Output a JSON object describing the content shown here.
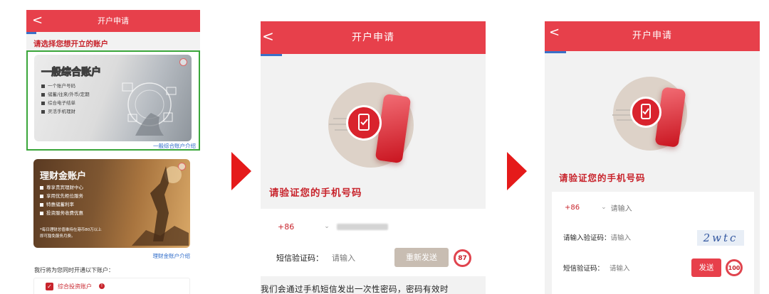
{
  "panel1": {
    "header_title": "开户申请",
    "back_icon": "<",
    "prompt": "请选择您想开立的账户",
    "card1": {
      "title": "一般综合账户",
      "features": [
        "一个账户号码",
        "储蓄/往来/外币/定期",
        "综合电子结单",
        "灵活手机理财"
      ],
      "link": "一般综合账户介绍"
    },
    "card2": {
      "title": "理财金账户",
      "features": [
        "尊享贵宾理财中心",
        "享用优先柜位服务",
        "特惠储蓄利率",
        "投资服务收费优惠"
      ],
      "note_line1": "*每日理财总值维持在港币80万以上",
      "note_line2": "即可豁免服务月费。",
      "link": "理财金账户介绍"
    },
    "also_open_text": "我行将为您同时开通以下账户：",
    "checkbox_label": "综合投资账户",
    "colors": {
      "accent": "#e7404b",
      "highlight_border": "#3aa63a",
      "link": "#2d6bc9"
    }
  },
  "panel2": {
    "header_title": "开户申请",
    "back_icon": "<",
    "verify_title": "请验证您的手机号码",
    "country_code": "+86",
    "sms_label": "短信验证码：",
    "sms_placeholder": "请输入",
    "resend_button": "重新发送",
    "countdown": "87",
    "footer_text": "我们会通过手机短信发出一次性密码，密码有效时"
  },
  "panel3": {
    "header_title": "开户申请",
    "back_icon": "<",
    "verify_title": "请验证您的手机号码",
    "country_code": "+86",
    "phone_placeholder": "请输入",
    "captcha_label": "请输入验证码：",
    "captcha_placeholder": "请输入",
    "captcha_image_text": "2wtc",
    "sms_label": "短信验证码：",
    "sms_placeholder": "请输入",
    "send_button": "发送",
    "countdown": "100"
  }
}
